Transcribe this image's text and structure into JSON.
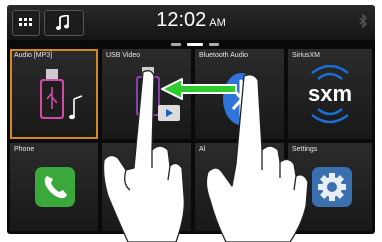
{
  "status_bar": {
    "menu_icon": "grid-menu-icon",
    "music_icon": "music-note-icon",
    "time": "12:02",
    "ampm": "AM",
    "bluetooth_icon": "bluetooth-icon"
  },
  "tiles": [
    {
      "label": "Audio [MP3]",
      "icon": "usb-music-icon",
      "active": true
    },
    {
      "label": "USB Video",
      "icon": "usb-video-icon",
      "active": false
    },
    {
      "label": "Bluetooth Audio",
      "icon": "bluetooth-audio-icon",
      "active": false
    },
    {
      "label": "SiriusXM",
      "icon": "sxm-logo",
      "logo_text": "sxm",
      "active": false
    },
    {
      "label": "Phone",
      "icon": "phone-icon",
      "active": false
    },
    {
      "label": "",
      "icon": "",
      "active": false
    },
    {
      "label": "Al",
      "icon": "",
      "active": false
    },
    {
      "label": "Settings",
      "icon": "gear-icon",
      "active": false
    }
  ],
  "overlay": {
    "arrow": "swipe-left-arrow",
    "hands": "two-finger-drag-gesture"
  },
  "colors": {
    "active_outline": "#d48a1a",
    "arrow_green": "#2ecc2e",
    "phone_green": "#3aa83a",
    "bluetooth_blue": "#2f74d8",
    "sxm_blue": "#1a6fd6"
  }
}
